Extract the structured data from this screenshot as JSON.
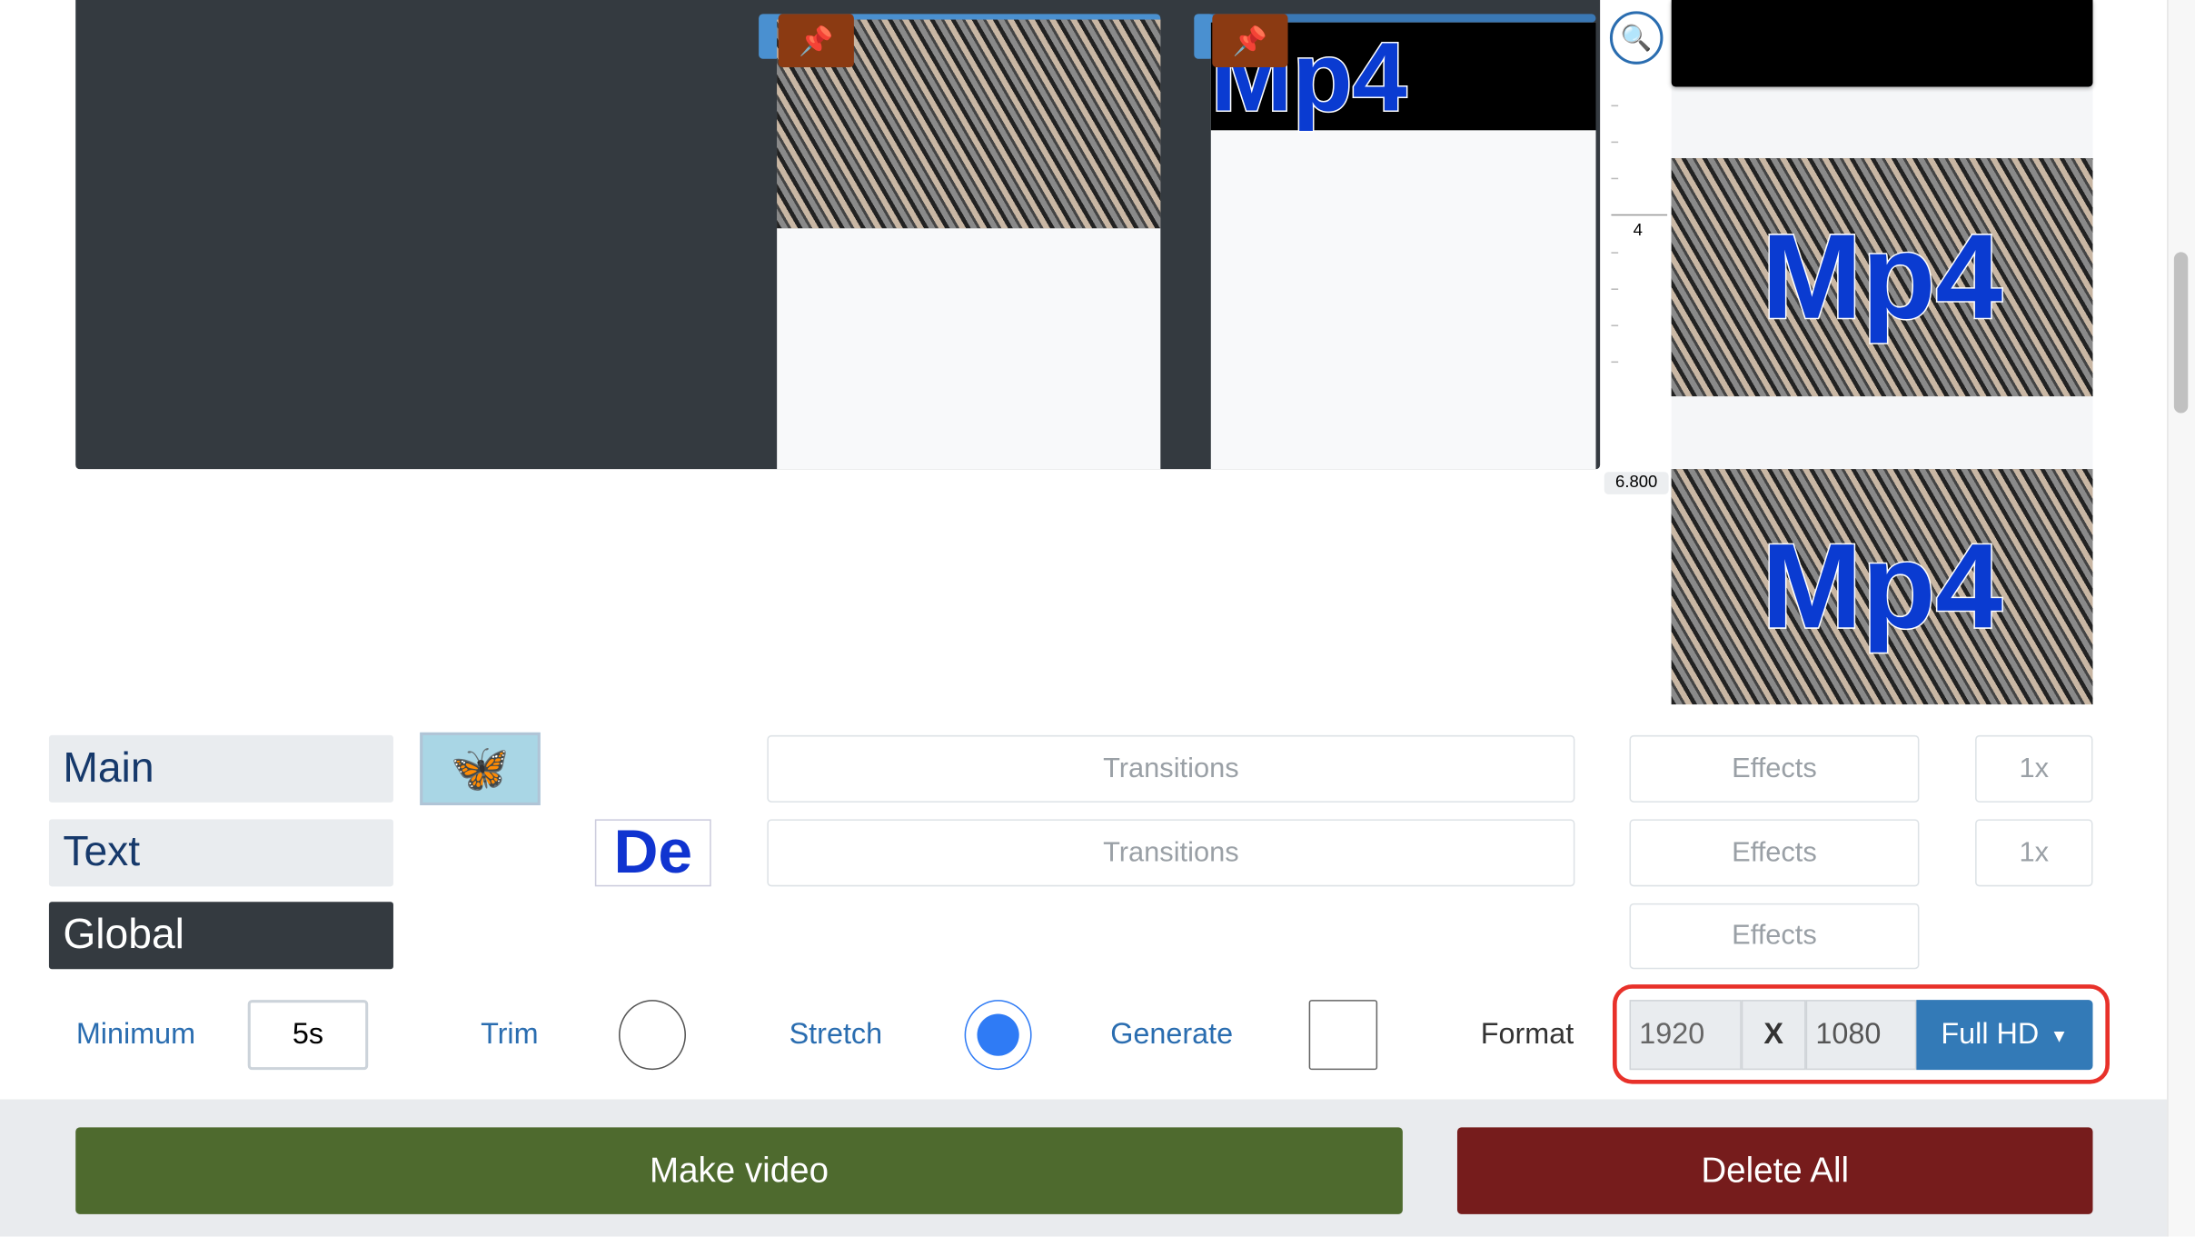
{
  "timeline": {
    "clip_overlay_text": "Mp4",
    "ruler": {
      "label_mid": "4",
      "label_end": "6.800"
    },
    "pin_icon": "pushpin-icon",
    "zoom_icon": "zoom-in-icon"
  },
  "preview": {
    "thumb_text": "Mp4"
  },
  "tracks": [
    {
      "label": "Main",
      "thumb": "butterfly",
      "transitions": "Transitions",
      "effects": "Effects",
      "speed": "1x"
    },
    {
      "label": "Text",
      "thumb_text": "De",
      "transitions": "Transitions",
      "effects": "Effects",
      "speed": "1x"
    },
    {
      "label": "Global",
      "effects": "Effects"
    }
  ],
  "options": {
    "minimum_label": "Minimum",
    "minimum_value": "5s",
    "trim_label": "Trim",
    "trim_selected": false,
    "stretch_label": "Stretch",
    "stretch_selected": true,
    "generate_label": "Generate",
    "generate_checked": false,
    "format_label": "Format",
    "width": "1920",
    "x_label": "X",
    "height": "1080",
    "preset": "Full HD"
  },
  "actions": {
    "make_video": "Make video",
    "delete_all": "Delete All"
  },
  "colors": {
    "make_video": "#4e6a2e",
    "delete_all": "#761c1c",
    "preset": "#337ab7",
    "highlight": "#e8312a"
  }
}
